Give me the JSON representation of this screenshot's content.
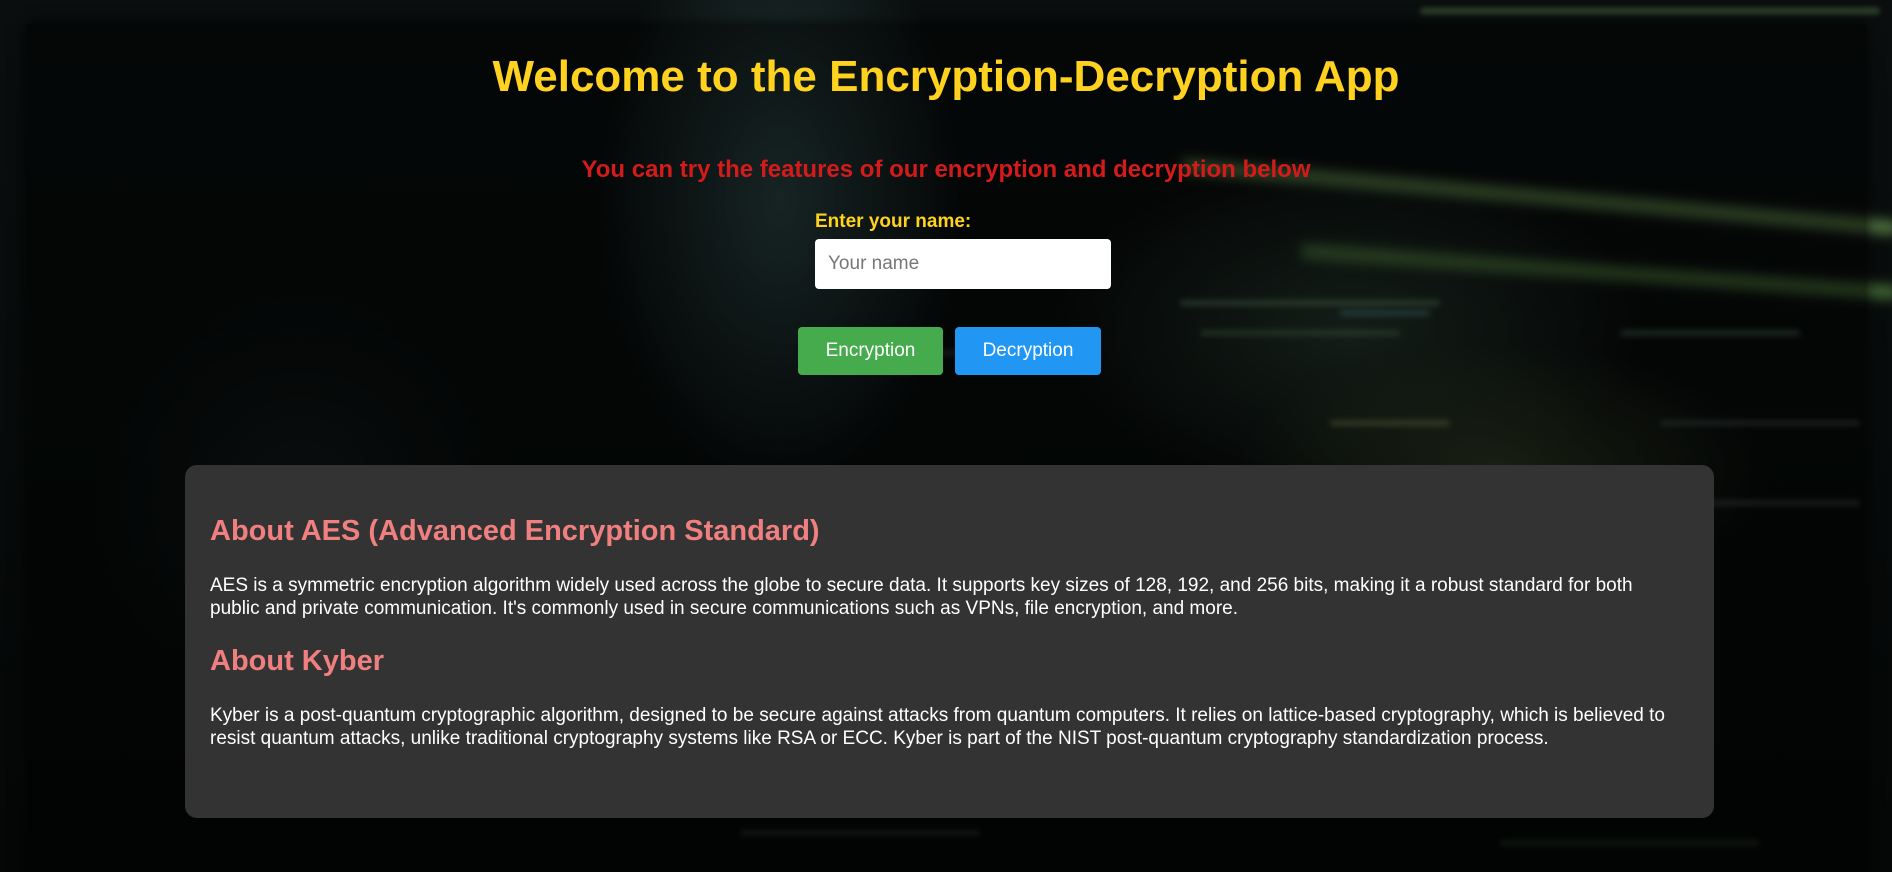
{
  "header": {
    "title": "Welcome to the Encryption-Decryption App",
    "subtitle": "You can try the features of our encryption and decryption below"
  },
  "form": {
    "name_label": "Enter your name:",
    "name_placeholder": "Your name",
    "name_value": ""
  },
  "buttons": {
    "encryption": "Encryption",
    "decryption": "Decryption"
  },
  "info": {
    "aes_heading": "About AES (Advanced Encryption Standard)",
    "aes_text": "AES is a symmetric encryption algorithm widely used across the globe to secure data. It supports key sizes of 128, 192, and 256 bits, making it a robust standard for both public and private communication. It's commonly used in secure communications such as VPNs, file encryption, and more.",
    "kyber_heading": "About Kyber",
    "kyber_text": "Kyber is a post-quantum cryptographic algorithm, designed to be secure against attacks from quantum computers. It relies on lattice-based cryptography, which is believed to resist quantum attacks, unlike traditional cryptography systems like RSA or ECC. Kyber is part of the NIST post-quantum cryptography standardization process."
  },
  "colors": {
    "title": "#ffd21f",
    "subtitle": "#d41b1b",
    "heading": "#f08080",
    "encrypt_button": "#45ab4c",
    "decrypt_button": "#2196f3",
    "panel": "#333333"
  }
}
